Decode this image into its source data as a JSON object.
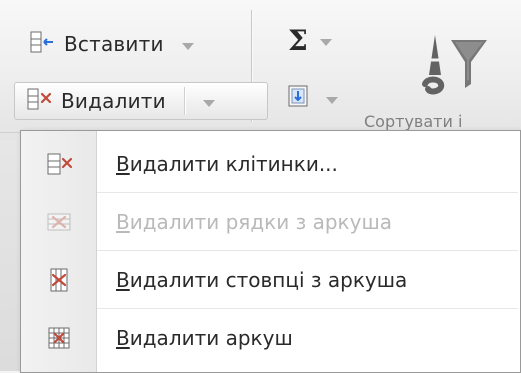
{
  "ribbon": {
    "insert": {
      "label": "Вставити",
      "icon": "insert-cells-icon"
    },
    "delete": {
      "label": "Видалити",
      "icon": "delete-cells-icon"
    },
    "sum": {
      "symbol": "Σ",
      "icon": "sum-icon"
    },
    "fill": {
      "icon": "fill-icon"
    },
    "sort_filter": {
      "icon": "sort-filter-icon"
    },
    "partial_label": "Сортувати і"
  },
  "menu": {
    "items": [
      {
        "label": "Видалити клітинки...",
        "enabled": true,
        "icon": "delete-cells-icon"
      },
      {
        "label": "Видалити рядки з аркуша",
        "enabled": false,
        "icon": "delete-rows-icon"
      },
      {
        "label": "Видалити стовпці з аркуша",
        "enabled": true,
        "icon": "delete-columns-icon"
      },
      {
        "label": "Видалити аркуш",
        "enabled": true,
        "icon": "delete-sheet-icon"
      }
    ]
  },
  "colors": {
    "menu_bg": "#ffffff",
    "menu_border": "#9a9a9a",
    "disabled_text": "#b9b9b9",
    "ribbon_bg": "#eeeeee"
  }
}
